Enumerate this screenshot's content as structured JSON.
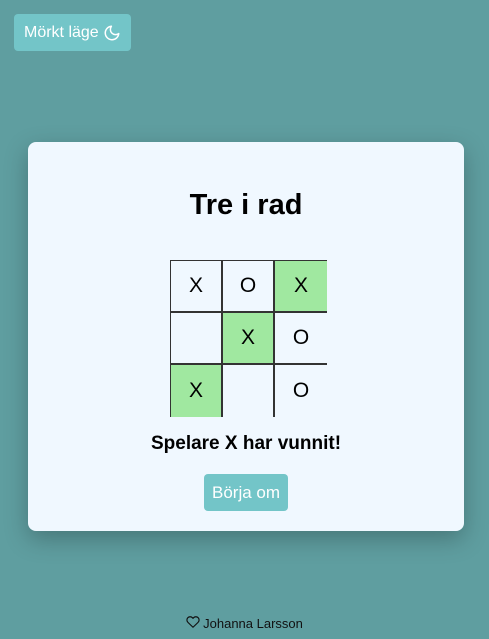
{
  "theme_toggle": {
    "label": "Mörkt läge",
    "icon": "moon-icon"
  },
  "game": {
    "title": "Tre i rad",
    "board": [
      [
        "X",
        "O",
        "X"
      ],
      [
        "",
        "X",
        "O"
      ],
      [
        "X",
        "",
        "O"
      ]
    ],
    "winning_cells": [
      [
        0,
        2
      ],
      [
        1,
        1
      ],
      [
        2,
        0
      ]
    ],
    "status": "Spelare X har vunnit!",
    "restart_label": "Börja om"
  },
  "footer": {
    "icon": "heart-icon",
    "author": "Johanna Larsson"
  },
  "colors": {
    "background": "#5f9ea0",
    "accent": "#73c5c8",
    "card": "#f0f8ff",
    "win_highlight": "#a0e8a0"
  }
}
